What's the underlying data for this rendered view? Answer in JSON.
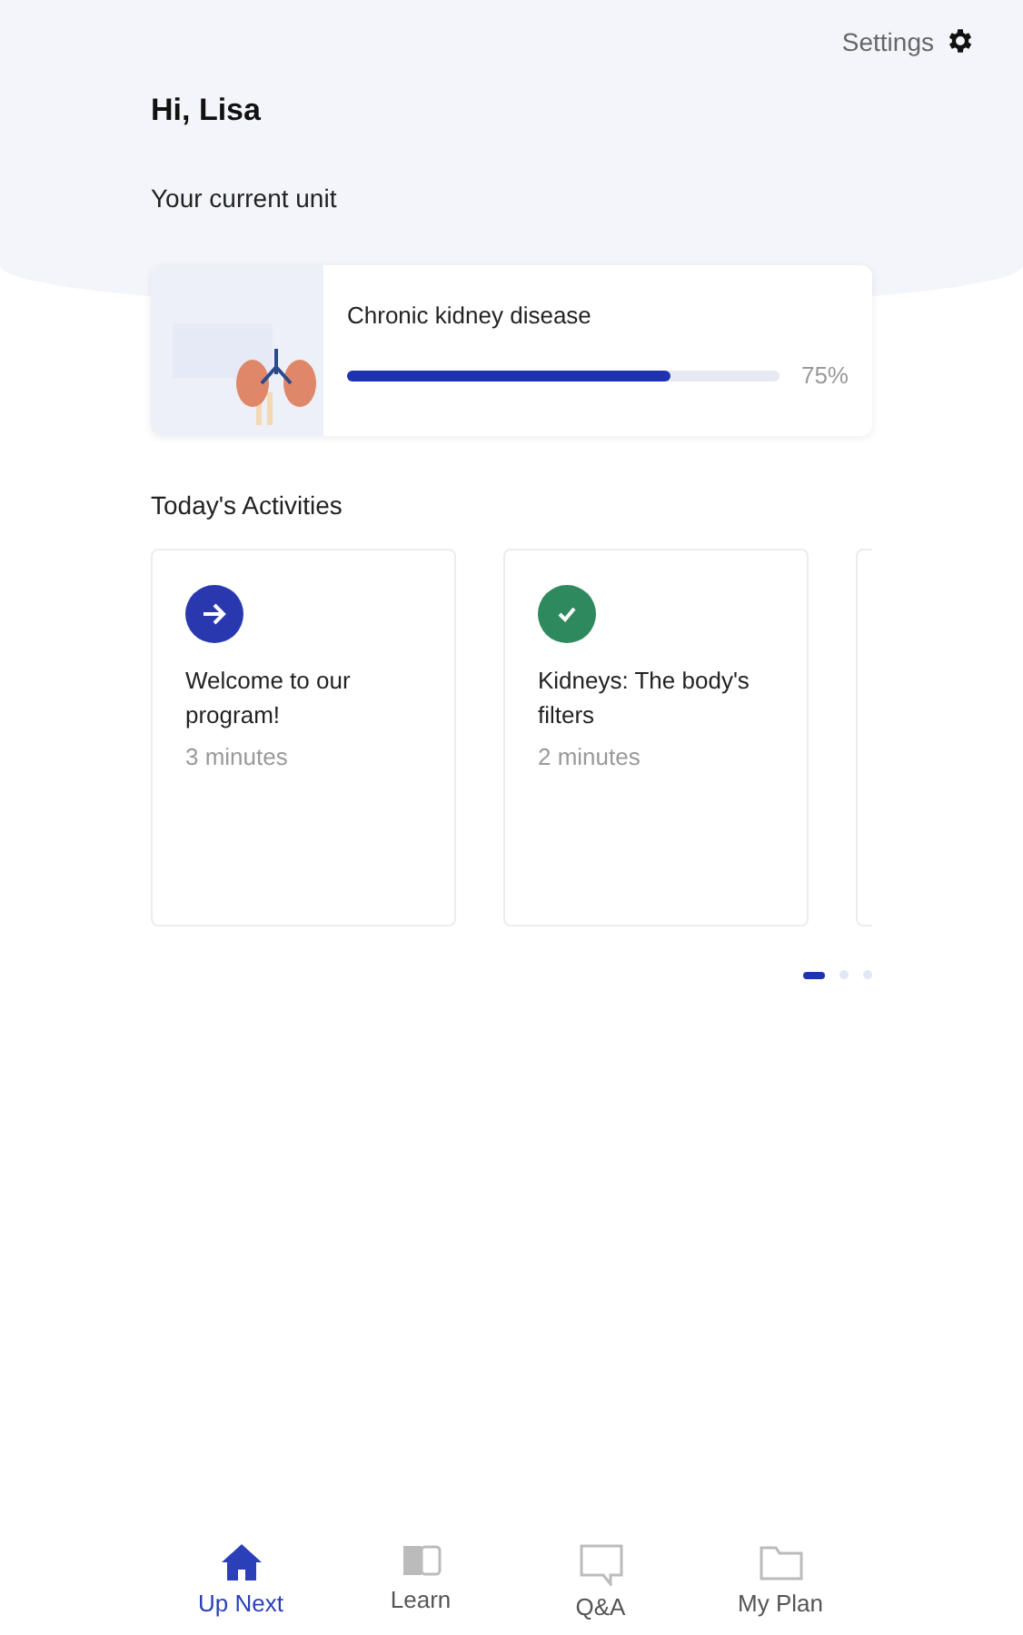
{
  "header": {
    "settings_label": "Settings",
    "greeting": "Hi, Lisa",
    "unit_heading": "Your current unit"
  },
  "current_unit": {
    "title": "Chronic kidney disease",
    "level": 0.75,
    "reading": "75%"
  },
  "activities_heading": "Today's Activities",
  "activities": [
    {
      "kind": "start",
      "title": "Welcome to our program!",
      "duration": "3 minutes"
    },
    {
      "kind": "done",
      "title": "Kidneys: The body's filters",
      "duration": "2 minutes"
    }
  ],
  "pager": [
    {
      "selected": true
    },
    {
      "selected": false
    },
    {
      "selected": false
    }
  ],
  "nav": [
    {
      "kind": "home",
      "label": "Up Next",
      "selected": true
    },
    {
      "kind": "book",
      "label": "Learn",
      "selected": false
    },
    {
      "kind": "chat",
      "label": "Q&A",
      "selected": false
    },
    {
      "kind": "folder",
      "label": "My Plan",
      "selected": false
    }
  ]
}
